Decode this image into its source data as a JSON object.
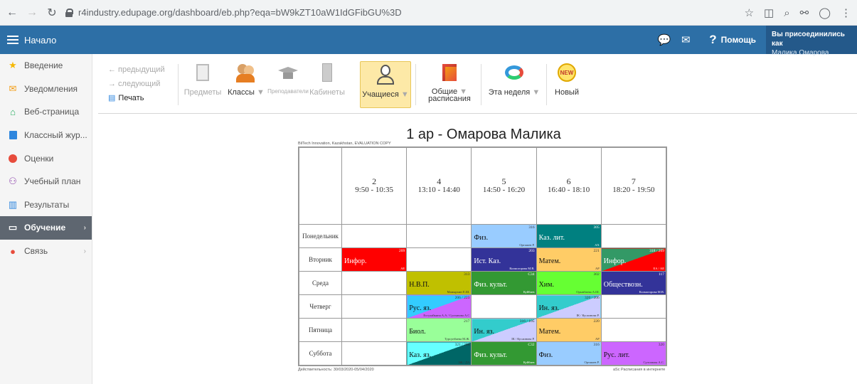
{
  "browser": {
    "url": "r4industry.edupage.org/dashboard/eb.php?eqa=bW9kZT10aW1IdGFibGU%3D"
  },
  "appbar": {
    "title": "Начало",
    "help": "Помощь",
    "user_line1": "Вы присоединились как",
    "user_line2": "Малика Омарова"
  },
  "sidebar": {
    "items": [
      {
        "label": "Введение",
        "icon": "star-icon"
      },
      {
        "label": "Уведомления",
        "icon": "envelope-icon"
      },
      {
        "label": "Веб-страница",
        "icon": "home-icon"
      },
      {
        "label": "Классный жур...",
        "icon": "journal-icon"
      },
      {
        "label": "Оценки",
        "icon": "grades-icon"
      },
      {
        "label": "Учебный план",
        "icon": "plan-icon"
      },
      {
        "label": "Результаты",
        "icon": "chart-icon"
      },
      {
        "label": "Обучение",
        "icon": "book-icon"
      },
      {
        "label": "Связь",
        "icon": "chat-icon"
      }
    ]
  },
  "toolbar": {
    "prev": "← предыдущий",
    "next": "→ следующий",
    "print": "Печать",
    "subjects": "Предметы",
    "classes": "Классы",
    "teachers": "Преподаватели",
    "rooms": "Кабинеты",
    "students": "Учащиеся",
    "general_line1": "Общие",
    "general_line2": "расписания",
    "week": "Эта неделя",
    "new": "Новый",
    "new_badge": "NEW"
  },
  "timetable": {
    "title": "1 ар - Омарова Малика",
    "org_note": "BilTech Innovation, Kazakhstan, EVALUATION COPY",
    "validity": "Действительность: 30/03/2020-05/04/2020",
    "footer_right": "aSc Расписания в интернете",
    "periods": [
      {
        "num": "2",
        "time": "9:50 - 10:35"
      },
      {
        "num": "4",
        "time": "13:10 - 14:40"
      },
      {
        "num": "5",
        "time": "14:50 - 16:20"
      },
      {
        "num": "6",
        "time": "16:40 - 18:10"
      },
      {
        "num": "7",
        "time": "18:20 - 19:50"
      }
    ],
    "days": [
      {
        "name": "Понедельник",
        "cells": [
          null,
          null,
          {
            "subject": "Физ.",
            "room": "316",
            "teacher": "Орташев Р.",
            "color": "#99ccff"
          },
          {
            "subject": "Каз. лит.",
            "room": "305",
            "teacher": "АХ",
            "color": "#008080",
            "light": true
          },
          null
        ]
      },
      {
        "name": "Вторник",
        "cells": [
          {
            "subject": "Инфор.",
            "room": "209",
            "teacher": "АЕ",
            "color": "#ff0000",
            "light": true
          },
          null,
          {
            "subject": "Ист. Каз.",
            "room": "203",
            "teacher": "Колмогорова М.В.",
            "color": "#333399",
            "light": true
          },
          {
            "subject": "Матем.",
            "room": "221",
            "teacher": "АР",
            "color": "#ffcc66"
          },
          {
            "subject": "Инфор.",
            "room": "318 / 209",
            "teacher": "ЕА / АЕ",
            "color": "#339966",
            "color2": "#ff0000",
            "light": true
          }
        ]
      },
      {
        "name": "Среда",
        "cells": [
          null,
          {
            "subject": "Н.В.П.",
            "room": "313",
            "teacher": "Мамырхин Е.Ш.",
            "color": "#c0c000"
          },
          {
            "subject": "Физ. культ.",
            "room": "С34",
            "teacher": "Куйбаев",
            "color": "#339933",
            "light": true
          },
          {
            "subject": "Хим.",
            "room": "302",
            "teacher": "Орынбаева А.Ш.",
            "color": "#66ff33"
          },
          {
            "subject": "Обществозн.",
            "room": "117",
            "teacher": "Колмогорова М.В.",
            "color": "#333399",
            "light": true
          }
        ]
      },
      {
        "name": "Четверг",
        "cells": [
          null,
          {
            "subject": "Рус. яз.",
            "room": "206 / 223",
            "teacher": "Есгулайкина А.А / Султанова А.С",
            "color": "#33ccff",
            "color2": "#cc66ff"
          },
          null,
          {
            "subject": "Ин. яз.",
            "room": "320 / 206",
            "teacher": "ІК / Кусаинова Р.",
            "color": "#33cccc",
            "color2": "#ccccff"
          },
          null
        ]
      },
      {
        "name": "Пятница",
        "cells": [
          null,
          {
            "subject": "Биол.",
            "room": "217",
            "teacher": "Турсунбаева М.Ж.",
            "color": "#99ff99"
          },
          {
            "subject": "Ин. яз.",
            "room": "316 / 105",
            "teacher": "ІК / Кусаинова Р.",
            "color": "#33cccc",
            "color2": "#ccccff"
          },
          {
            "subject": "Матем.",
            "room": "220",
            "teacher": "АР",
            "color": "#ffcc66"
          },
          null
        ]
      },
      {
        "name": "Суббота",
        "cells": [
          null,
          {
            "subject": "Каз. яз.",
            "room": "321 / 306",
            "teacher": "ЗЖ / ДА",
            "color": "#66ffff",
            "color2": "#006666"
          },
          {
            "subject": "Физ. культ.",
            "room": "С32",
            "teacher": "Куйбаев",
            "color": "#339933",
            "light": true
          },
          {
            "subject": "Физ.",
            "room": "316",
            "teacher": "Орташев Р.",
            "color": "#99ccff"
          },
          {
            "subject": "Рус. лит.",
            "room": "320",
            "teacher": "Султанова А.С.",
            "color": "#cc66ff"
          }
        ]
      }
    ]
  }
}
